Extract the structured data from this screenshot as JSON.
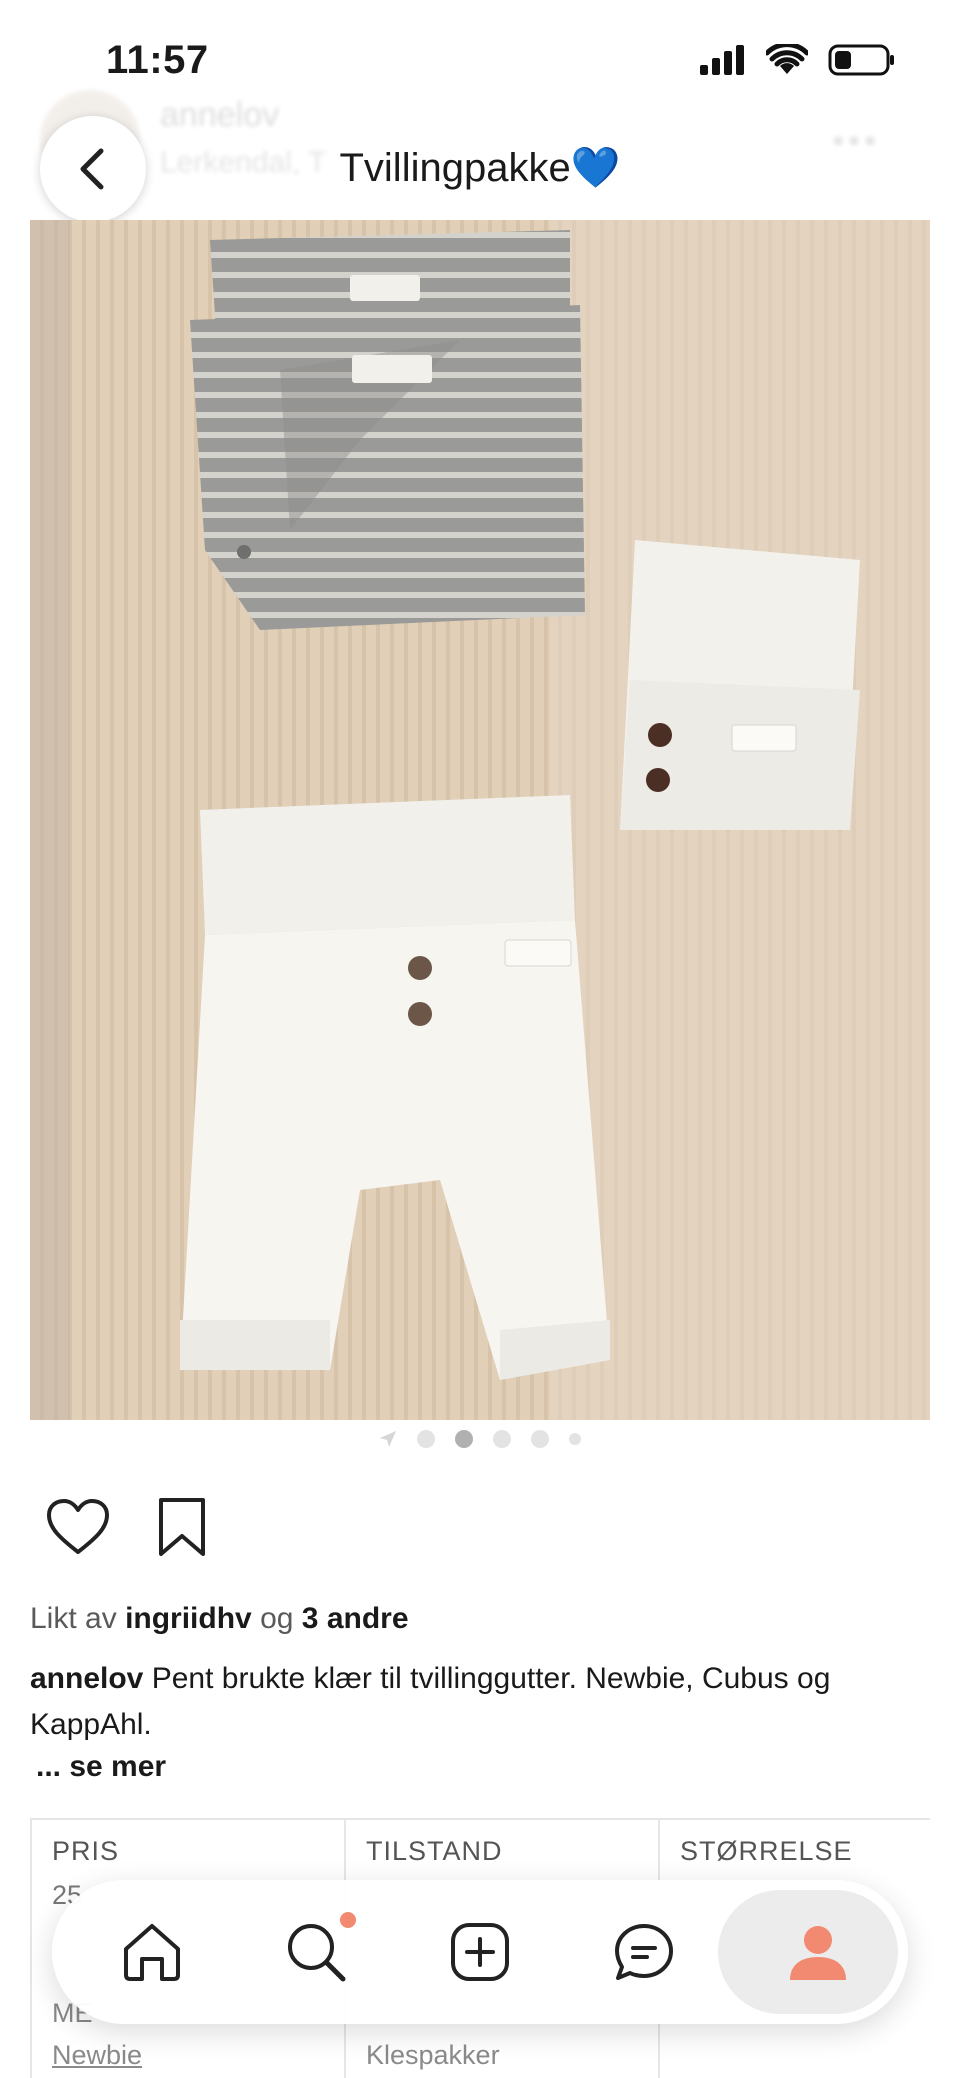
{
  "status_bar": {
    "time": "11:57"
  },
  "header": {
    "title": "Tvillingpakke",
    "title_emoji": "💙",
    "bg_user_name": "annelov",
    "bg_location": "Lerkendal, T",
    "bg_more": "•••"
  },
  "photo": {
    "description_alt": "Tvillingpakke"
  },
  "carousel": {
    "total": 6,
    "active_index": 2
  },
  "post": {
    "likes_prefix": "Likt av",
    "likes_user": "ingriidhv",
    "likes_mid": "og",
    "likes_others": "3 andre",
    "author": "annelov",
    "caption": "Pent brukte klær til tvillinggutter. Newbie, Cubus og KappAhl.",
    "see_more": "... se mer"
  },
  "details": {
    "price_label": "PRIS",
    "price_value": "25",
    "condition_label": "TILSTAND",
    "size_label": "STØRRELSE",
    "brand_label": "ME",
    "brand_value": "Newbie",
    "category_value": "Klespakker"
  },
  "bottom_nav": {
    "items": [
      "home",
      "search",
      "add",
      "messages",
      "profile"
    ]
  },
  "colors": {
    "accent": "#f28a72",
    "heart_emoji": "#5fc3f0"
  }
}
